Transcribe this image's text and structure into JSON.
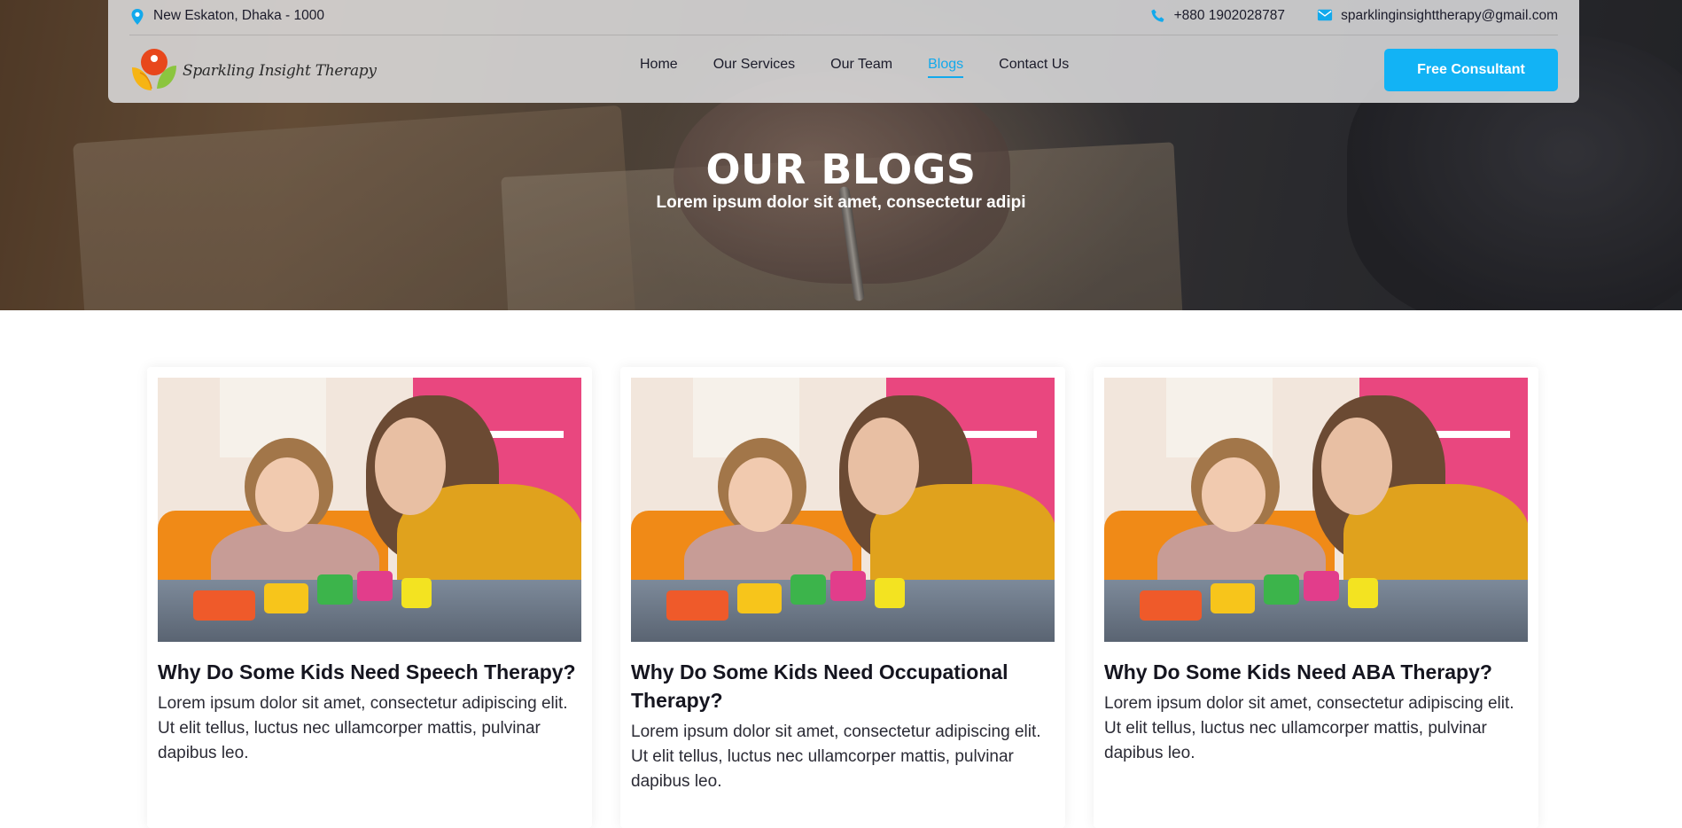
{
  "topbar": {
    "location": "New Eskaton, Dhaka - 1000",
    "phone": "+880 1902028787",
    "email": "sparklinginsighttherapy@gmail.com"
  },
  "brand": {
    "name": "Sparkling Insight Therapy"
  },
  "nav": {
    "items": [
      {
        "label": "Home",
        "active": false
      },
      {
        "label": "Our Services",
        "active": false
      },
      {
        "label": "Our Team",
        "active": false
      },
      {
        "label": "Blogs",
        "active": true
      },
      {
        "label": "Contact Us",
        "active": false
      }
    ],
    "cta_label": "Free Consultant"
  },
  "hero": {
    "title": "OUR BLOGS",
    "subtitle": "Lorem ipsum dolor sit amet, consectetur adipi"
  },
  "blogs": [
    {
      "title": "Why Do Some Kids Need Speech Therapy?",
      "excerpt": "Lorem ipsum dolor sit amet, consectetur adipiscing elit. Ut elit tellus, luctus nec ullamcorper mattis, pulvinar dapibus leo."
    },
    {
      "title": "Why Do Some Kids Need Occupational Therapy?",
      "excerpt": "Lorem ipsum dolor sit amet, consectetur adipiscing elit. Ut elit tellus, luctus nec ullamcorper mattis, pulvinar dapibus leo."
    },
    {
      "title": "Why Do Some Kids Need ABA Therapy?",
      "excerpt": "Lorem ipsum dolor sit amet, consectetur adipiscing elit. Ut elit tellus, luctus nec ullamcorper mattis, pulvinar dapibus leo."
    }
  ],
  "colors": {
    "accent": "#12b3f5",
    "active_link": "#12a9ec"
  },
  "icons": {
    "location": "map-pin-icon",
    "phone": "phone-icon",
    "email": "mail-icon"
  }
}
